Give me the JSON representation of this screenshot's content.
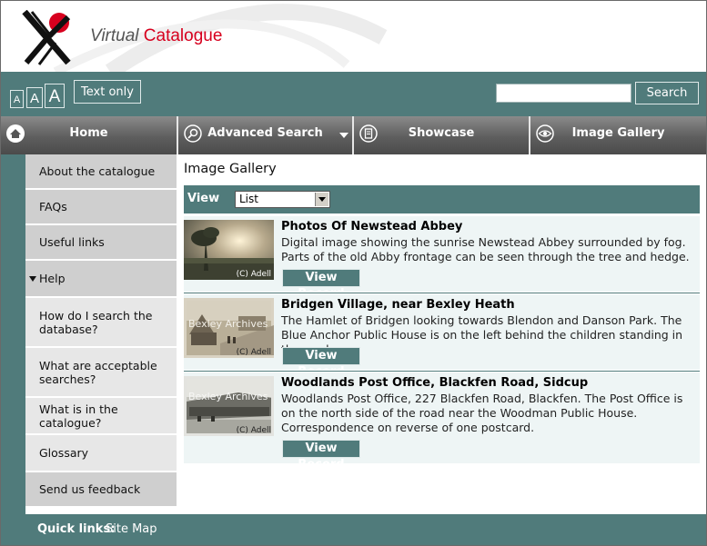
{
  "header": {
    "brand_prefix": "Virtual",
    "brand_suffix": "Catalogue"
  },
  "toolbar": {
    "font_sizes": [
      "A",
      "A",
      "A"
    ],
    "text_only": "Text only",
    "search_value": "",
    "search_button": "Search"
  },
  "nav": {
    "home": "Home",
    "advanced_search": "Advanced Search",
    "showcase": "Showcase",
    "image_gallery": "Image Gallery"
  },
  "sidebar": {
    "items": [
      {
        "label": "About the catalogue"
      },
      {
        "label": "FAQs"
      },
      {
        "label": "Useful links"
      },
      {
        "label": "Help"
      },
      {
        "label": "How do I search the database?"
      },
      {
        "label": "What are acceptable searches?"
      },
      {
        "label": "What is in the catalogue?"
      },
      {
        "label": "Glossary"
      },
      {
        "label": "Send us feedback"
      }
    ]
  },
  "main": {
    "title": "Image Gallery",
    "view_label": "View",
    "view_selected": "List",
    "records": [
      {
        "title": "Photos Of Newstead Abbey",
        "description": "Digital image showing the sunrise Newstead Abbey surrounded by fog. Parts of the old Abby frontage can be seen through the tree and hedge.",
        "credit": "(C) Adell",
        "button": "View Record"
      },
      {
        "title": "Bridgen Village, near Bexley Heath",
        "description": "The Hamlet of Bridgen looking towards Blendon and Danson Park. The Blue Anchor Public House is on the left behind the children standing in the road.",
        "credit": "(C) Adell",
        "watermark": "Bexley Archives",
        "button": "View Record"
      },
      {
        "title": "Woodlands Post Office, Blackfen Road, Sidcup",
        "description": "Woodlands Post Office, 227 Blackfen Road, Blackfen. The Post Office is on the north side of the road near the Woodman Public House. Correspondence on reverse of one postcard.",
        "credit": "(C) Adell",
        "watermark": "Bexley Archives",
        "button": "View Record"
      }
    ]
  },
  "footer": {
    "quick_links_label": "Quick links:",
    "site_map": "Site Map"
  },
  "colors": {
    "teal": "#507b7b",
    "accent_red": "#d7001e",
    "sidebar_grey": "#cfcfcf"
  }
}
